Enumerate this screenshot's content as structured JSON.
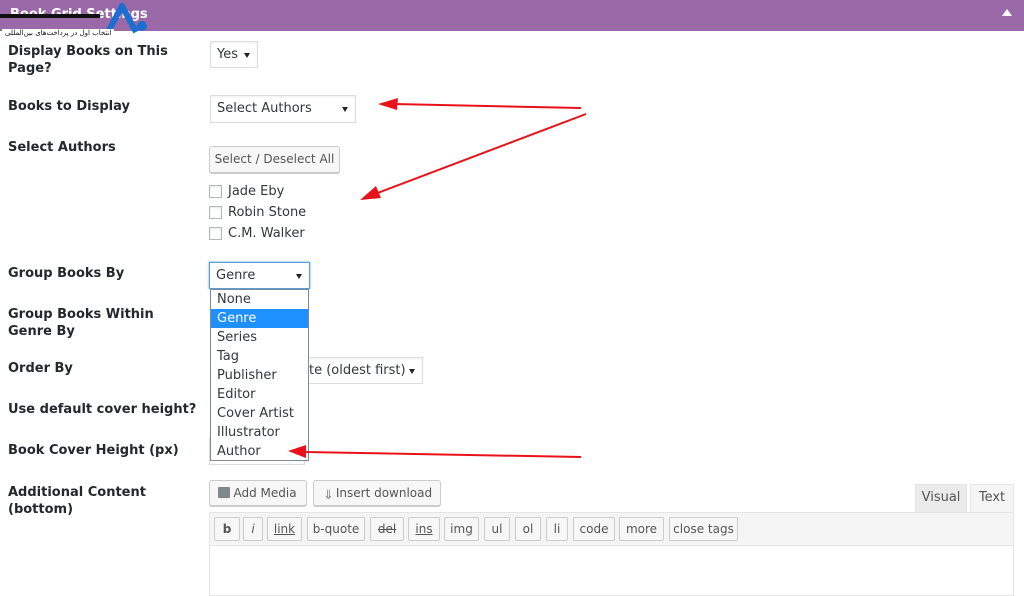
{
  "header": {
    "title": "Book Grid Settings"
  },
  "logo": {
    "tagline": "انتخاب اول در پرداخت‌های بین‌المللی"
  },
  "fields": {
    "display_books": {
      "label": "Display Books on This Page?",
      "value": "Yes"
    },
    "books_to_display": {
      "label": "Books to Display",
      "value": "Select Authors"
    },
    "select_authors": {
      "label": "Select Authors",
      "button": "Select / Deselect All",
      "authors": [
        "Jade Eby",
        "Robin Stone",
        "C.M. Walker"
      ]
    },
    "group_by": {
      "label": "Group Books By",
      "value": "Genre",
      "options": [
        "None",
        "Genre",
        "Series",
        "Tag",
        "Publisher",
        "Editor",
        "Cover Artist",
        "Illustrator",
        "Author"
      ],
      "selected_index": 1
    },
    "group_within": {
      "label": "Group Books Within Genre By"
    },
    "order_by": {
      "label": "Order By",
      "value_visible": "te (oldest first)"
    },
    "default_cover_height": {
      "label": "Use default cover height?"
    },
    "cover_height": {
      "label": "Book Cover Height (px)"
    },
    "additional_content": {
      "label": "Additional Content (bottom)"
    }
  },
  "editor": {
    "add_media": "Add Media",
    "insert_download": "Insert download",
    "tabs": [
      "Visual",
      "Text"
    ],
    "quicktags": [
      "b",
      "i",
      "link",
      "b-quote",
      "del",
      "ins",
      "img",
      "ul",
      "ol",
      "li",
      "code",
      "more",
      "close tags"
    ]
  },
  "colors": {
    "header_bg": "#9a6aa8",
    "annotation_arrow": "#e8121a",
    "selected_option": "#1e90ff"
  }
}
